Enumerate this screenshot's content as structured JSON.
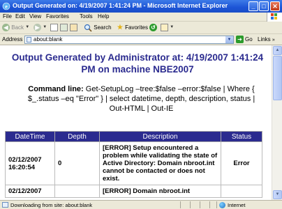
{
  "window": {
    "title": "Output Generated on: 4/19/2007 1:41:24 PM - Microsoft Internet Explorer",
    "minimize_glyph": "_",
    "maximize_glyph": "□",
    "close_glyph": "✕"
  },
  "menu": {
    "items": [
      "File",
      "Edit",
      "View",
      "Favorites",
      "Tools",
      "Help"
    ]
  },
  "toolbar": {
    "back_label": "Back",
    "search_label": "Search",
    "favorites_label": "Favorites"
  },
  "address_bar": {
    "label": "Address",
    "value": "about:blank",
    "go_label": "Go",
    "links_label": "Links"
  },
  "page": {
    "heading": "Output Generated by Administrator at: 4/19/2007 1:41:24 PM on machine NBE2007",
    "command_label": "Command line:",
    "command_text": " Get-SetupLog –tree:$false –error:$false | Where { $_.status –eq \"Error\" } | select datetime, depth, description, status | Out-HTML | Out-IE",
    "table": {
      "columns": [
        "DateTime",
        "Depth",
        "Description",
        "Status"
      ],
      "rows": [
        {
          "datetime": "02/12/2007 16:20:54",
          "depth": "0",
          "description": "[ERROR] Setup encountered a problem while validating the state of Active Directory: Domain nbroot.int cannot be contacted or does not exist.",
          "status": "Error"
        },
        {
          "datetime": "02/12/2007",
          "depth": "",
          "description": "[ERROR] Domain nbroot.int",
          "status": ""
        }
      ]
    }
  },
  "status_bar": {
    "text": "Downloading from site: about:blank",
    "zone": "Internet"
  },
  "colors": {
    "titlebar": "#1c54d6",
    "heading": "#2b2b8f",
    "table_header_bg": "#2b2b8f",
    "chrome_bg": "#ece9d8"
  },
  "icons": [
    "ie-icon",
    "back-arrow-icon",
    "forward-arrow-icon",
    "stop-icon",
    "refresh-icon",
    "home-icon",
    "search-icon",
    "favorites-star-icon",
    "history-icon",
    "page-icon",
    "go-arrow-icon",
    "globe-icon"
  ]
}
